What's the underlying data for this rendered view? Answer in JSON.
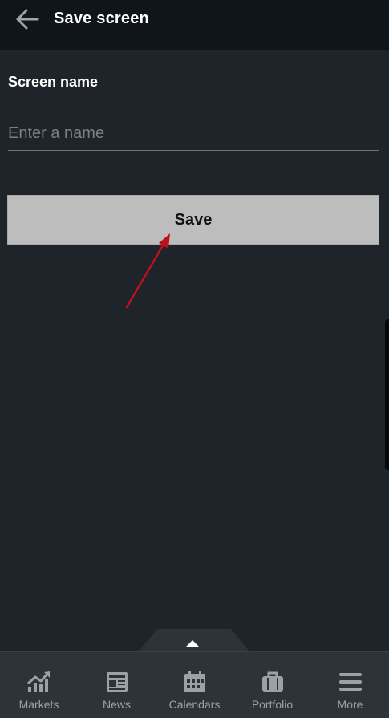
{
  "header": {
    "title": "Save screen",
    "back_icon": "arrow-left-icon"
  },
  "form": {
    "label": "Screen name",
    "placeholder": "Enter a name",
    "value": ""
  },
  "save_button": {
    "label": "Save"
  },
  "annotation": {
    "color": "#c0111a"
  },
  "bottom_nav": {
    "items": [
      {
        "label": "Markets",
        "icon": "chart-icon"
      },
      {
        "label": "News",
        "icon": "newspaper-icon"
      },
      {
        "label": "Calendars",
        "icon": "calendar-icon"
      },
      {
        "label": "Portfolio",
        "icon": "briefcase-icon"
      },
      {
        "label": "More",
        "icon": "menu-icon"
      }
    ]
  },
  "colors": {
    "header_bg": "#10151b",
    "page_bg": "#1f242a",
    "button_bg": "#bdbdbd",
    "nav_bg": "#2d3339"
  }
}
